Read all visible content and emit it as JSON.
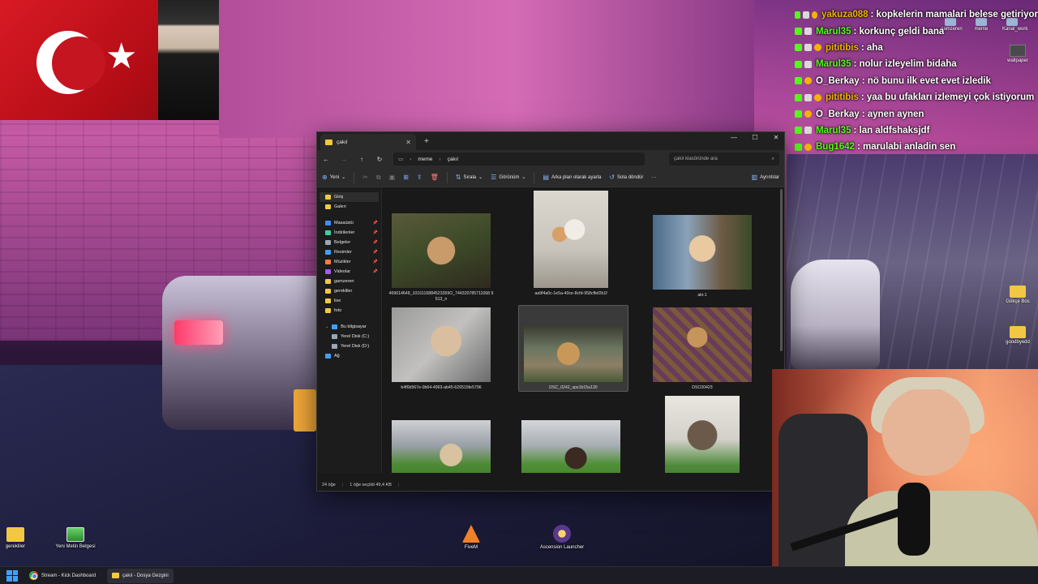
{
  "chat": [
    {
      "user": "yakuza088",
      "user_color": "#f2b400",
      "message": ": kopkelerin mamalari belese getiriyor"
    },
    {
      "user": "Marul35",
      "user_color": "#53fc18",
      "message": ": korkunç geldi bana"
    },
    {
      "user": "pititibis",
      "user_color": "#f2b400",
      "message": ": aha"
    },
    {
      "user": "Marul35",
      "user_color": "#53fc18",
      "message": ": nolur izleyelim bidaha"
    },
    {
      "user": "O_Berkay",
      "user_color": "#ffffff",
      "message": ": nö bunu ilk evet evet izledik"
    },
    {
      "user": "pititibis",
      "user_color": "#f2b400",
      "message": ": yaa bu ufakları izlemeyi çok istiyorum"
    },
    {
      "user": "O_Berkay",
      "user_color": "#ffffff",
      "message": ": aynen aynen"
    },
    {
      "user": "Marul35",
      "user_color": "#53fc18",
      "message": ": lan aldfshaksjdf"
    },
    {
      "user": "Bug1642",
      "user_color": "#53fc18",
      "message": ": marulabi anladin sen"
    }
  ],
  "desktop_top_icons": [
    "gamzeren",
    "meme",
    "Kanal_work"
  ],
  "wallpaper_icon": "wallpaper",
  "right_folders": [
    "Gökçe Bos",
    "goodbyedd"
  ],
  "explorer": {
    "tab_title": "çakıl",
    "tab_close": "✕",
    "tab_add": "+",
    "window_controls": [
      "—",
      "☐",
      "✕"
    ],
    "nav": {
      "back": "←",
      "forward": "→",
      "up": "↑",
      "refresh": "↻"
    },
    "breadcrumb": [
      "meme",
      "çakıl"
    ],
    "search_placeholder": "çakıl klasöründe ara",
    "toolbar": {
      "new": "Yeni",
      "sort": "Sırala",
      "view": "Görünüm",
      "set_background": "Arka plan olarak ayarla",
      "rotate_left": "Sola döndür",
      "more": "···",
      "details": "Ayrıntılar"
    },
    "sidebar": {
      "top": [
        {
          "label": "Giriş",
          "icon": "home-icon",
          "color": "#f2c744",
          "active": true
        },
        {
          "label": "Galeri",
          "icon": "gallery-icon",
          "color": "#f2c744",
          "active": false
        }
      ],
      "pinned": [
        {
          "label": "Masaüstü",
          "icon": "desktop-icon",
          "color": "#3f8cff",
          "pin": true
        },
        {
          "label": "İndirilenler",
          "icon": "downloads-icon",
          "color": "#3fd0a0",
          "pin": true
        },
        {
          "label": "Belgeler",
          "icon": "documents-icon",
          "color": "#9aa7b8",
          "pin": true
        },
        {
          "label": "Resimler",
          "icon": "pictures-icon",
          "color": "#3fa0ff",
          "pin": true
        },
        {
          "label": "Müzikler",
          "icon": "music-icon",
          "color": "#ff7b3f",
          "pin": true
        },
        {
          "label": "Videolar",
          "icon": "videos-icon",
          "color": "#a05aff",
          "pin": true
        },
        {
          "label": "gamzeren",
          "icon": "folder-icon",
          "color": "#f2c744",
          "pin": false
        },
        {
          "label": "gerekliler",
          "icon": "folder-icon",
          "color": "#f2c744",
          "pin": false
        },
        {
          "label": "lise",
          "icon": "folder-icon",
          "color": "#f2c744",
          "pin": false
        },
        {
          "label": "foto",
          "icon": "folder-icon",
          "color": "#f2c744",
          "pin": false
        }
      ],
      "this_pc": {
        "label": "Bu bilgisayar",
        "color": "#3fa0ff"
      },
      "drives": [
        {
          "label": "Yerel Disk (C:)",
          "color": "#9aa7b8"
        },
        {
          "label": "Yerel Disk (D:)",
          "color": "#9aa7b8"
        }
      ],
      "network": {
        "label": "Ağ",
        "color": "#3fa0ff"
      }
    },
    "files": [
      {
        "name": "469614648_1016116884523359O_744320785711068 9513_n",
        "selected": false
      },
      {
        "name": "aa9f4a0c-1e5a-40ce-8cfd-958cffef2b1f",
        "selected": false
      },
      {
        "name": "aki-1",
        "selected": false
      },
      {
        "name": "b4f6b567e-0b64-4963-ab45-626515fe5796",
        "selected": false
      },
      {
        "name": "DSC_0242_sps1b15a130",
        "selected": true
      },
      {
        "name": "DSC00423",
        "selected": false
      },
      {
        "name": "",
        "selected": false
      },
      {
        "name": "",
        "selected": false
      },
      {
        "name": "",
        "selected": false
      }
    ],
    "status": {
      "count": "24 öğe",
      "selected": "1 öğe seçildi 49,4 KB"
    }
  },
  "desktop_icons": [
    {
      "label": "gerekliler",
      "icon": "folder-icon"
    },
    {
      "label": "Yeni Metin Belgesi",
      "icon": "text-document-icon"
    },
    {
      "label": "FiveM",
      "icon": "fivem-icon"
    },
    {
      "label": "Ascension Launcher",
      "icon": "ascension-icon"
    }
  ],
  "taskbar": {
    "items": [
      {
        "label": "Stream - Kick Dashboard",
        "icon": "chrome-icon",
        "active": false
      },
      {
        "label": "çakıl - Dosya Gezgini",
        "icon": "folder-icon",
        "active": true
      }
    ]
  }
}
